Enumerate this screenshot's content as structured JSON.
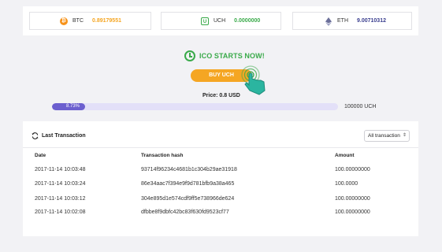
{
  "wallets": [
    {
      "symbol": "BTC",
      "value": "0.89179551",
      "icon": "bitcoin-icon",
      "color": "#f7931a"
    },
    {
      "symbol": "UCH",
      "value": "0.0000000",
      "icon": "uch-icon",
      "color": "#3aaa4a"
    },
    {
      "symbol": "ETH",
      "value": "9.00710312",
      "icon": "ethereum-icon",
      "color": "#3b3f8f"
    }
  ],
  "ico": {
    "heading": "ICO STARTS NOW!",
    "buy_label": "BUY UCH",
    "price": "Price: 0.8 USD",
    "progress_label": "8.73%",
    "progress_fraction": 0.0873,
    "cap": "100000 UCH"
  },
  "transactions": {
    "title": "Last Transaction",
    "filter_selected": "All transaction",
    "columns": [
      "Date",
      "Transaction hash",
      "Amount"
    ],
    "rows": [
      {
        "date": "2017-11-14 10:03:48",
        "hash": "93714f96234c4681b1c304b29ae31918",
        "amount": "100.00000000"
      },
      {
        "date": "2017-11-14 10:03:24",
        "hash": "86e34aac7f394e9f9d781bfb9a38a465",
        "amount": "100.0000"
      },
      {
        "date": "2017-11-14 10:03:12",
        "hash": "304e895d1e574cdf9ff5e738966de624",
        "amount": "100.00000000"
      },
      {
        "date": "2017-11-14 10:02:08",
        "hash": "dfbbe8f9dbfc42bc83f630fd9523cf77",
        "amount": "100.00000000"
      }
    ]
  },
  "colors": {
    "accent_green": "#3aaa4a",
    "button_orange": "#f5a623",
    "progress_purple": "#6c5fcf",
    "btc_value": "#f5a623",
    "uch_value": "#3aaa4a",
    "eth_value": "#3b3f8f"
  }
}
